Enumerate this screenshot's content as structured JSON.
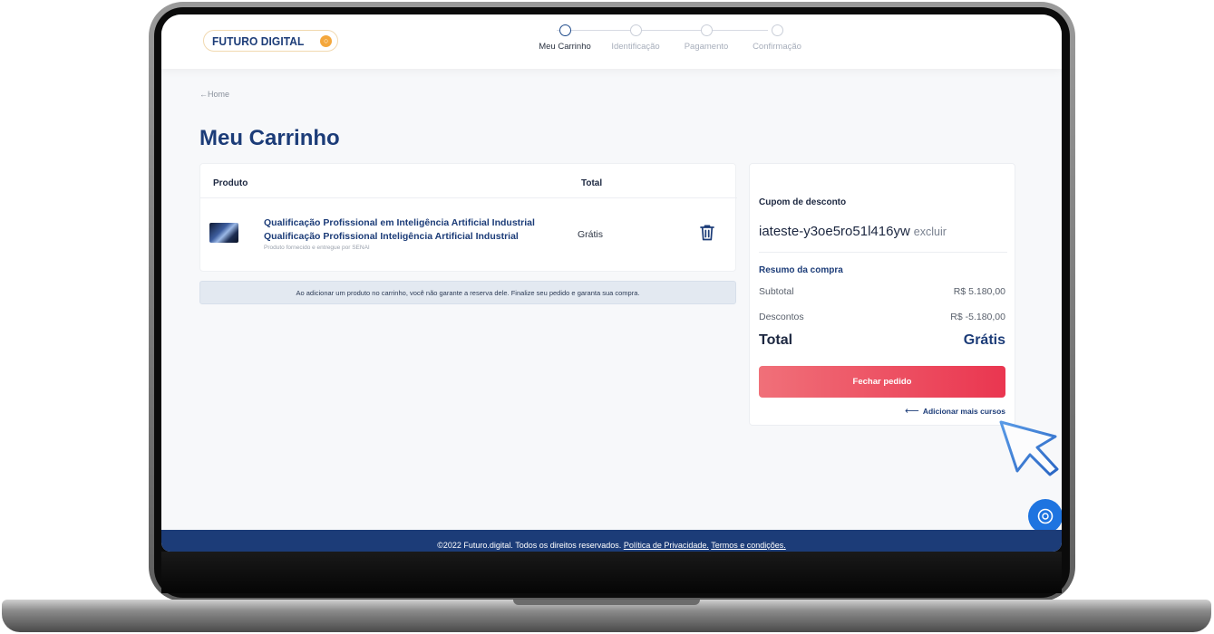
{
  "header": {
    "logo_text": "FUTURO DIGITAL",
    "logo_coin": "○",
    "steps": [
      {
        "label": "Meu Carrinho",
        "active": true
      },
      {
        "label": "Identificação",
        "active": false
      },
      {
        "label": "Pagamento",
        "active": false
      },
      {
        "label": "Confirmação",
        "active": false
      }
    ]
  },
  "breadcrumb": {
    "back_label": "Home"
  },
  "page_title": "Meu Carrinho",
  "cart": {
    "col_product": "Produto",
    "col_total": "Total",
    "items": [
      {
        "name_line1": "Qualificação Profissional em Inteligência Artificial Industrial",
        "name_line2": "Qualificação Profissional Inteligência Artificial Industrial",
        "provider": "Produto fornecido e entregue por SENAI",
        "price": "Grátis"
      }
    ],
    "notice": "Ao adicionar um produto no carrinho, você não garante a reserva dele. Finalize seu pedido e garanta sua compra."
  },
  "summary": {
    "coupon_label": "Cupom de desconto",
    "coupon_code": "iateste-y3oe5ro51l416yw",
    "coupon_remove": "excluir",
    "title": "Resumo da compra",
    "subtotal_label": "Subtotal",
    "subtotal_value": "R$ 5.180,00",
    "discount_label": "Descontos",
    "discount_value": "R$ -5.180,00",
    "total_label": "Total",
    "total_value": "Grátis",
    "checkout_button": "Fechar pedido",
    "add_more_link": "Adicionar mais cursos"
  },
  "footer": {
    "copyright": "©2022 Futuro.digital. Todos os direitos reservados.",
    "privacy_link": "Política de Privacidade.",
    "terms_link": "Termos e condições."
  },
  "colors": {
    "brand_blue": "#1c3c78",
    "accent_red": "#ea3650",
    "help_blue": "#1e74e0"
  }
}
